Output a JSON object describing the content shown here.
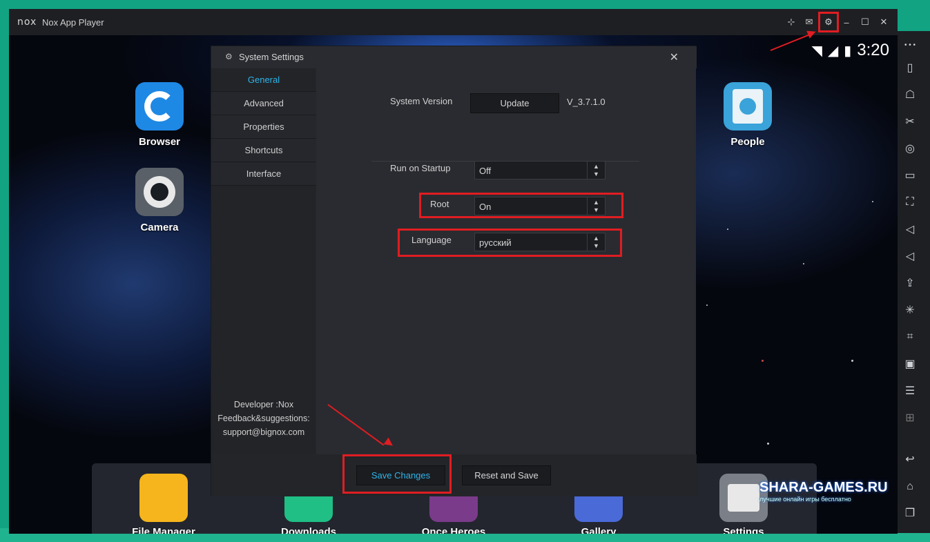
{
  "window": {
    "logo": "nox",
    "title": "Nox App Player",
    "title_icons": [
      "pin-icon",
      "mail-icon",
      "gear-icon",
      "minimize-icon",
      "maximize-icon",
      "close-icon"
    ]
  },
  "status": {
    "time": "3:20"
  },
  "desktop": {
    "icons": [
      {
        "label": "Browser",
        "color": "#1e88e5"
      },
      {
        "label": "Camera",
        "color": "#5a6068"
      },
      {
        "label": "People",
        "color": "#3aa3d9"
      }
    ],
    "dock": [
      {
        "label": "File Manager",
        "color": "#f6b51c"
      },
      {
        "label": "Downloads",
        "color": "#1fbf85"
      },
      {
        "label": "Once Heroes",
        "color": "#7a3b8a"
      },
      {
        "label": "Gallery",
        "color": "#4a6ad8"
      },
      {
        "label": "Settings",
        "color": "#7b8088"
      }
    ]
  },
  "dialog": {
    "title": "System Settings",
    "nav": [
      "General",
      "Advanced",
      "Properties",
      "Shortcuts",
      "Interface"
    ],
    "active_nav": "General",
    "developer": "Developer :Nox",
    "feedback": "Feedback&suggestions:",
    "email": "support@bignox.com",
    "system_version_label": "System Version",
    "update_button": "Update",
    "version": "V_3.7.1.0",
    "run_on_startup_label": "Run on Startup",
    "run_on_startup_value": "Off",
    "root_label": "Root",
    "root_value": "On",
    "language_label": "Language",
    "language_value": "русский",
    "save_button": "Save Changes",
    "reset_button": "Reset and Save"
  },
  "watermark": {
    "text": "SHARA-GAMES.RU",
    "sub": "лучшие онлайн игры бесплатно"
  },
  "colors": {
    "accent": "#2fb5e8",
    "highlight": "#e01d22",
    "background": "#12a383"
  }
}
